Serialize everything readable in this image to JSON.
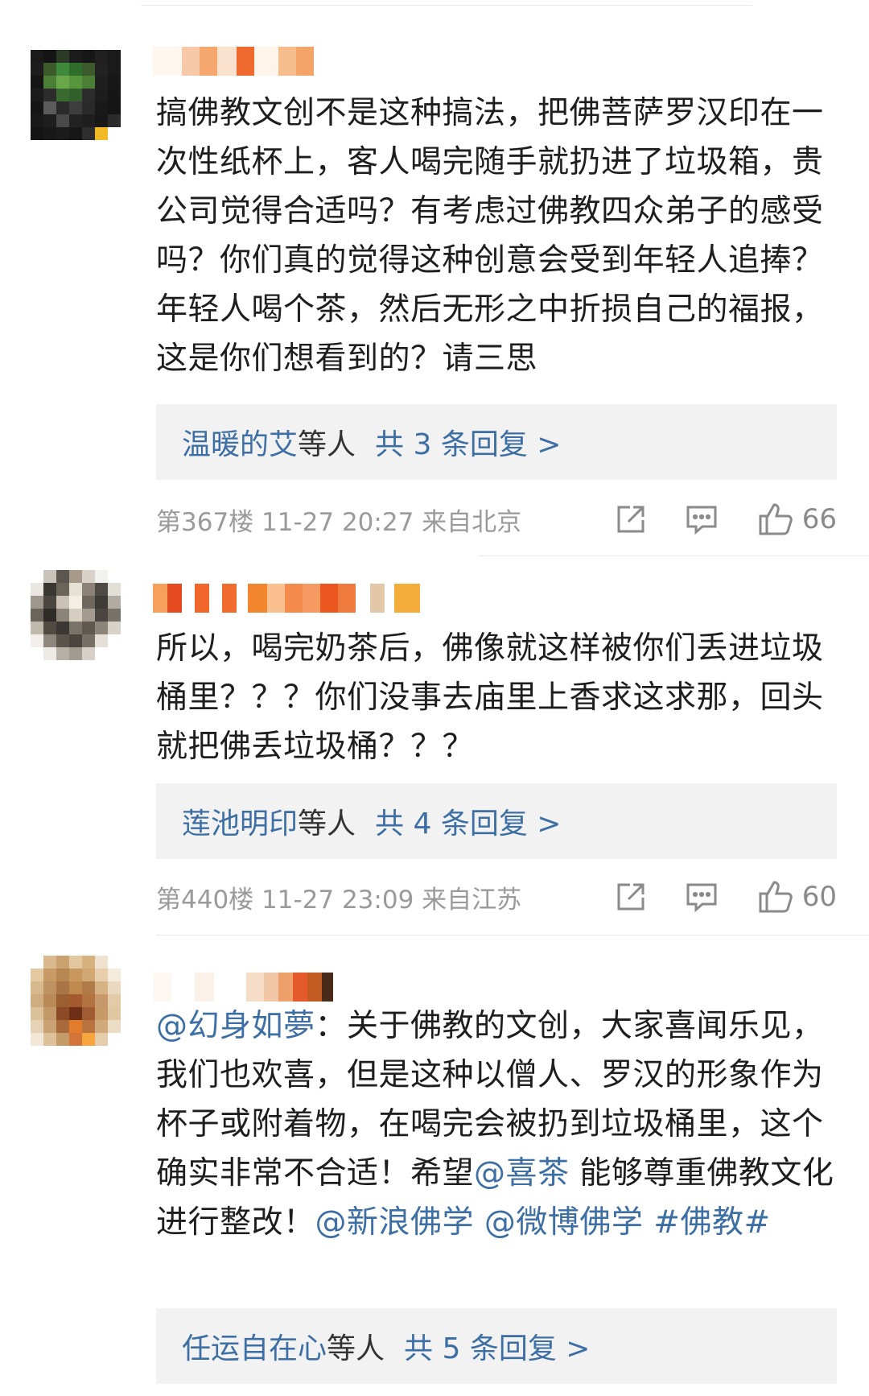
{
  "comments": [
    {
      "text_parts": [
        {
          "t": "搞佛教文创不是这种搞法，把佛菩萨罗汉印在一次性纸杯上，客人喝完随手就扔进了垃圾箱，贵公司觉得合适吗？有考虑过佛教四众弟子的感受吗？你们真的觉得这种创意会受到年轻人追捧？年轻人喝个茶，然后无形之中折损自己的福报，这是你们想看到的？请三思",
          "link": false
        }
      ],
      "reply_name": "温暖的艾",
      "reply_mid": "等人",
      "reply_count": "共 3 条回复 >",
      "meta": "第367楼 11-27 20:27 来自北京",
      "likes": "66"
    },
    {
      "text_parts": [
        {
          "t": "所以，喝完奶茶后，佛像就这样被你们丢进垃圾桶里？？？你们没事去庙里上香求这求那，回头就把佛丢垃圾桶？？？",
          "link": false
        }
      ],
      "reply_name": "莲池明印",
      "reply_mid": "等人",
      "reply_count": "共 4 条回复 >",
      "meta": "第440楼 11-27 23:09 来自江苏",
      "likes": "60"
    },
    {
      "text_parts": [
        {
          "t": "@幻身如夢",
          "link": true
        },
        {
          "t": "：关于佛教的文创，大家喜闻乐见，我们也欢喜，但是这种以僧人、罗汉的形象作为杯子或附着物，在喝完会被扔到垃圾桶里，这个确实非常不合适！希望",
          "link": false
        },
        {
          "t": "@喜茶",
          "link": true
        },
        {
          "t": " 能够尊重佛教文化进行整改！",
          "link": false
        },
        {
          "t": "@新浪佛学 @微博佛学 #佛教#",
          "link": true
        }
      ],
      "reply_name": "任运自在心",
      "reply_mid": "等人",
      "reply_count": "共 5 条回复 >",
      "meta": "",
      "likes": ""
    }
  ],
  "colors": {
    "link": "#3d6fa5",
    "reply_bg": "#f2f2f2",
    "meta": "#9a9a9a"
  },
  "icons": {
    "repost": "share-icon",
    "comment": "comment-icon",
    "like": "thumbs-up-icon"
  }
}
